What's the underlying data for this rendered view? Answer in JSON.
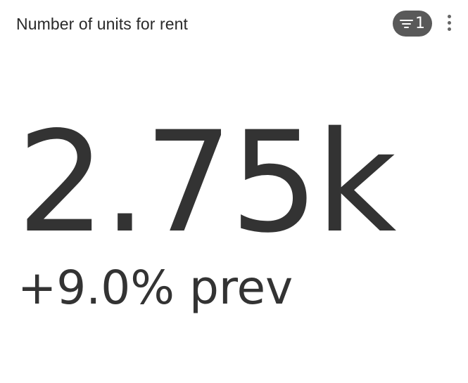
{
  "card": {
    "title": "Number of units for rent",
    "filter_badge": {
      "icon": "filter-lines-icon",
      "count": "1",
      "color": "#595959"
    },
    "more_menu_icon": "vertical-ellipsis-icon"
  },
  "metric": {
    "value": "2.75k",
    "comparison": "+9.0% prev"
  }
}
